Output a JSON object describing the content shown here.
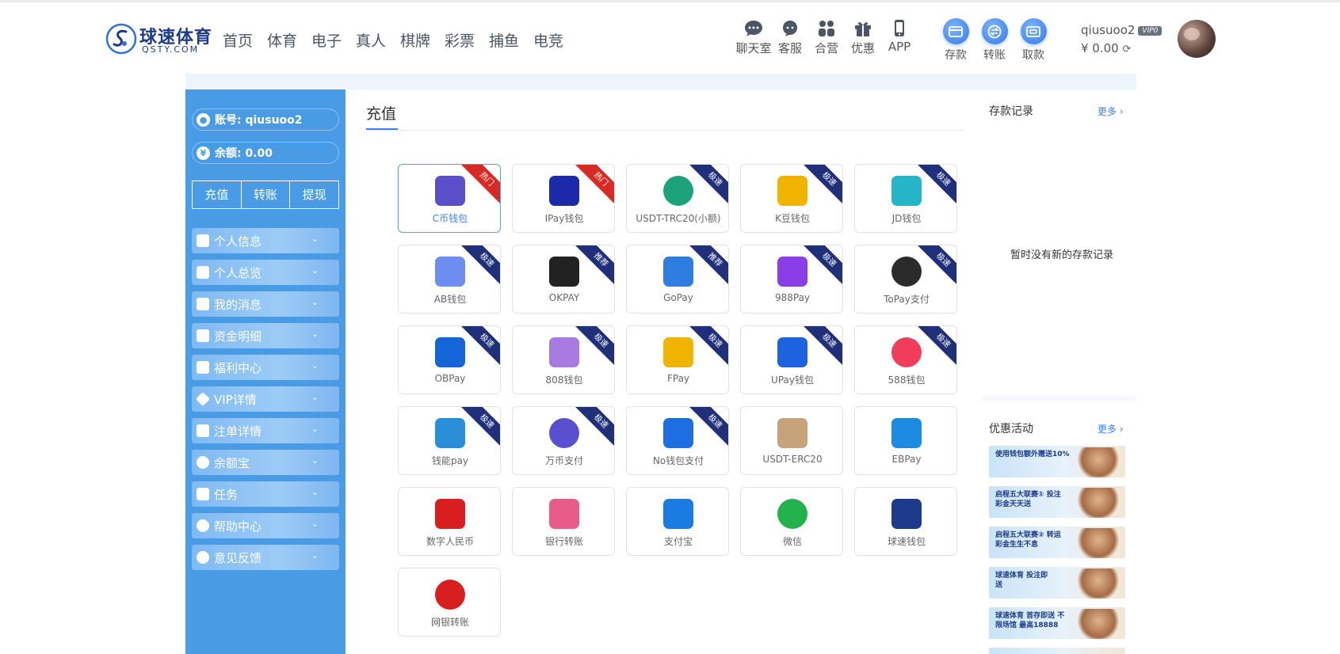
{
  "brand": {
    "name": "球速体育",
    "sub": "QSTY.COM"
  },
  "nav": [
    "首页",
    "体育",
    "电子",
    "真人",
    "棋牌",
    "彩票",
    "捕鱼",
    "电竞"
  ],
  "tools": [
    {
      "label": "聊天室",
      "icon": "chat-icon"
    },
    {
      "label": "客服",
      "icon": "support-icon"
    },
    {
      "label": "合营",
      "icon": "partner-icon"
    },
    {
      "label": "优惠",
      "icon": "gift-icon"
    },
    {
      "label": "APP",
      "icon": "phone-icon"
    }
  ],
  "money_actions": [
    {
      "label": "存款",
      "icon": "deposit-icon"
    },
    {
      "label": "转账",
      "icon": "transfer-icon"
    },
    {
      "label": "取款",
      "icon": "withdraw-icon"
    }
  ],
  "user": {
    "name": "qiusuoo2",
    "vip": "VIP0",
    "balance": "¥ 0.00"
  },
  "sidebar": {
    "account_label": "账号: qiusuoo2",
    "balance_label": "余额: 0.00",
    "buttons": [
      "充值",
      "转账",
      "提现"
    ],
    "menu": [
      {
        "label": "个人信息",
        "icon": "id-card-icon"
      },
      {
        "label": "个人总览",
        "icon": "calendar-icon"
      },
      {
        "label": "我的消息",
        "icon": "message-icon"
      },
      {
        "label": "资金明细",
        "icon": "ledger-icon"
      },
      {
        "label": "福利中心",
        "icon": "gift-icon"
      },
      {
        "label": "VIP详情",
        "icon": "diamond-icon"
      },
      {
        "label": "注单详情",
        "icon": "clipboard-icon"
      },
      {
        "label": "余额宝",
        "icon": "money-bag-icon"
      },
      {
        "label": "任务",
        "icon": "task-list-icon"
      },
      {
        "label": "帮助中心",
        "icon": "help-icon"
      },
      {
        "label": "意见反馈",
        "icon": "feedback-icon"
      }
    ]
  },
  "main": {
    "title": "充值",
    "methods": [
      {
        "label": "C币钱包",
        "badge": "热门",
        "badge_type": "hot",
        "icon": "c-coin-icon",
        "color": "#5b4fc9"
      },
      {
        "label": "IPay钱包",
        "badge": "热门",
        "badge_type": "hot",
        "icon": "ipay-icon",
        "color": "#1a2aa8"
      },
      {
        "label": "USDT-TRC20(小额)",
        "badge": "极速",
        "badge_type": "fast",
        "icon": "tether-icon",
        "color": "#1ba27a"
      },
      {
        "label": "K豆钱包",
        "badge": "极速",
        "badge_type": "fast",
        "icon": "k-bean-icon",
        "color": "#f0b400"
      },
      {
        "label": "JD钱包",
        "badge": "极速",
        "badge_type": "fast",
        "icon": "jd-icon",
        "color": "#26b5c8"
      },
      {
        "label": "AB钱包",
        "badge": "极速",
        "badge_type": "fast",
        "icon": "ab-wallet-icon",
        "color": "#6d8df0"
      },
      {
        "label": "OKPAY",
        "badge": "推荐",
        "badge_type": "fast",
        "icon": "okpay-icon",
        "color": "#222222"
      },
      {
        "label": "GoPay",
        "badge": "推荐",
        "badge_type": "fast",
        "icon": "gopay-icon",
        "color": "#2f7de1"
      },
      {
        "label": "988Pay",
        "badge": "极速",
        "badge_type": "fast",
        "icon": "988pay-icon",
        "color": "#8a3ee8"
      },
      {
        "label": "ToPay支付",
        "badge": "极速",
        "badge_type": "fast",
        "icon": "topay-icon",
        "color": "#2b2b2b"
      },
      {
        "label": "OBPay",
        "badge": "极速",
        "badge_type": "fast",
        "icon": "obpay-icon",
        "color": "#1565d8"
      },
      {
        "label": "808钱包",
        "badge": "极速",
        "badge_type": "fast",
        "icon": "808-icon",
        "color": "#a77be0"
      },
      {
        "label": "FPay",
        "badge": "极速",
        "badge_type": "fast",
        "icon": "fpay-icon",
        "color": "#f0b400"
      },
      {
        "label": "UPay钱包",
        "badge": "极速",
        "badge_type": "fast",
        "icon": "upay-icon",
        "color": "#1d63e0"
      },
      {
        "label": "588钱包",
        "badge": "极速",
        "badge_type": "fast",
        "icon": "588-icon",
        "color": "#ef3d5b"
      },
      {
        "label": "钱能pay",
        "badge": "极速",
        "badge_type": "fast",
        "icon": "qianneng-icon",
        "color": "#2a8fd8"
      },
      {
        "label": "万币支付",
        "badge": "极速",
        "badge_type": "fast",
        "icon": "wanbi-icon",
        "color": "#5a4fcf"
      },
      {
        "label": "No钱包支付",
        "badge": "极速",
        "badge_type": "fast",
        "icon": "no-wallet-icon",
        "color": "#1d6ee0"
      },
      {
        "label": "USDT-ERC20",
        "badge": "",
        "badge_type": "",
        "icon": "erc20-icon",
        "color": "#c7a27a"
      },
      {
        "label": "EBPay",
        "badge": "",
        "badge_type": "",
        "icon": "ebpay-icon",
        "color": "#1d8be0"
      },
      {
        "label": "数字人民币",
        "badge": "",
        "badge_type": "",
        "icon": "digital-rmb-icon",
        "color": "#d81e1e"
      },
      {
        "label": "银行转账",
        "badge": "",
        "badge_type": "",
        "icon": "bank-transfer-icon",
        "color": "#e85c8a"
      },
      {
        "label": "支付宝",
        "badge": "",
        "badge_type": "",
        "icon": "alipay-icon",
        "color": "#1a7ce0"
      },
      {
        "label": "微信",
        "badge": "",
        "badge_type": "",
        "icon": "wechat-icon",
        "color": "#22b14c"
      },
      {
        "label": "球速钱包",
        "badge": "",
        "badge_type": "",
        "icon": "qsty-wallet-icon",
        "color": "#1e3a8a"
      },
      {
        "label": "网银转账",
        "badge": "",
        "badge_type": "",
        "icon": "online-bank-icon",
        "color": "#d81e1e"
      }
    ]
  },
  "right": {
    "deposit_title": "存款记录",
    "deposit_more": "更多 ›",
    "deposit_empty": "暂时没有新的存款记录",
    "promo_title": "优惠活动",
    "promo_more": "更多 ›",
    "promos": [
      {
        "text": "使用钱包额外赠送10%"
      },
      {
        "text": "启程五大联赛① 投注彩金天天送"
      },
      {
        "text": "启程五大联赛② 转运彩金生生不息"
      },
      {
        "text": "球速体育 投注即送"
      },
      {
        "text": "球速体育 首存即送 不限场馆 最高18888"
      }
    ]
  }
}
